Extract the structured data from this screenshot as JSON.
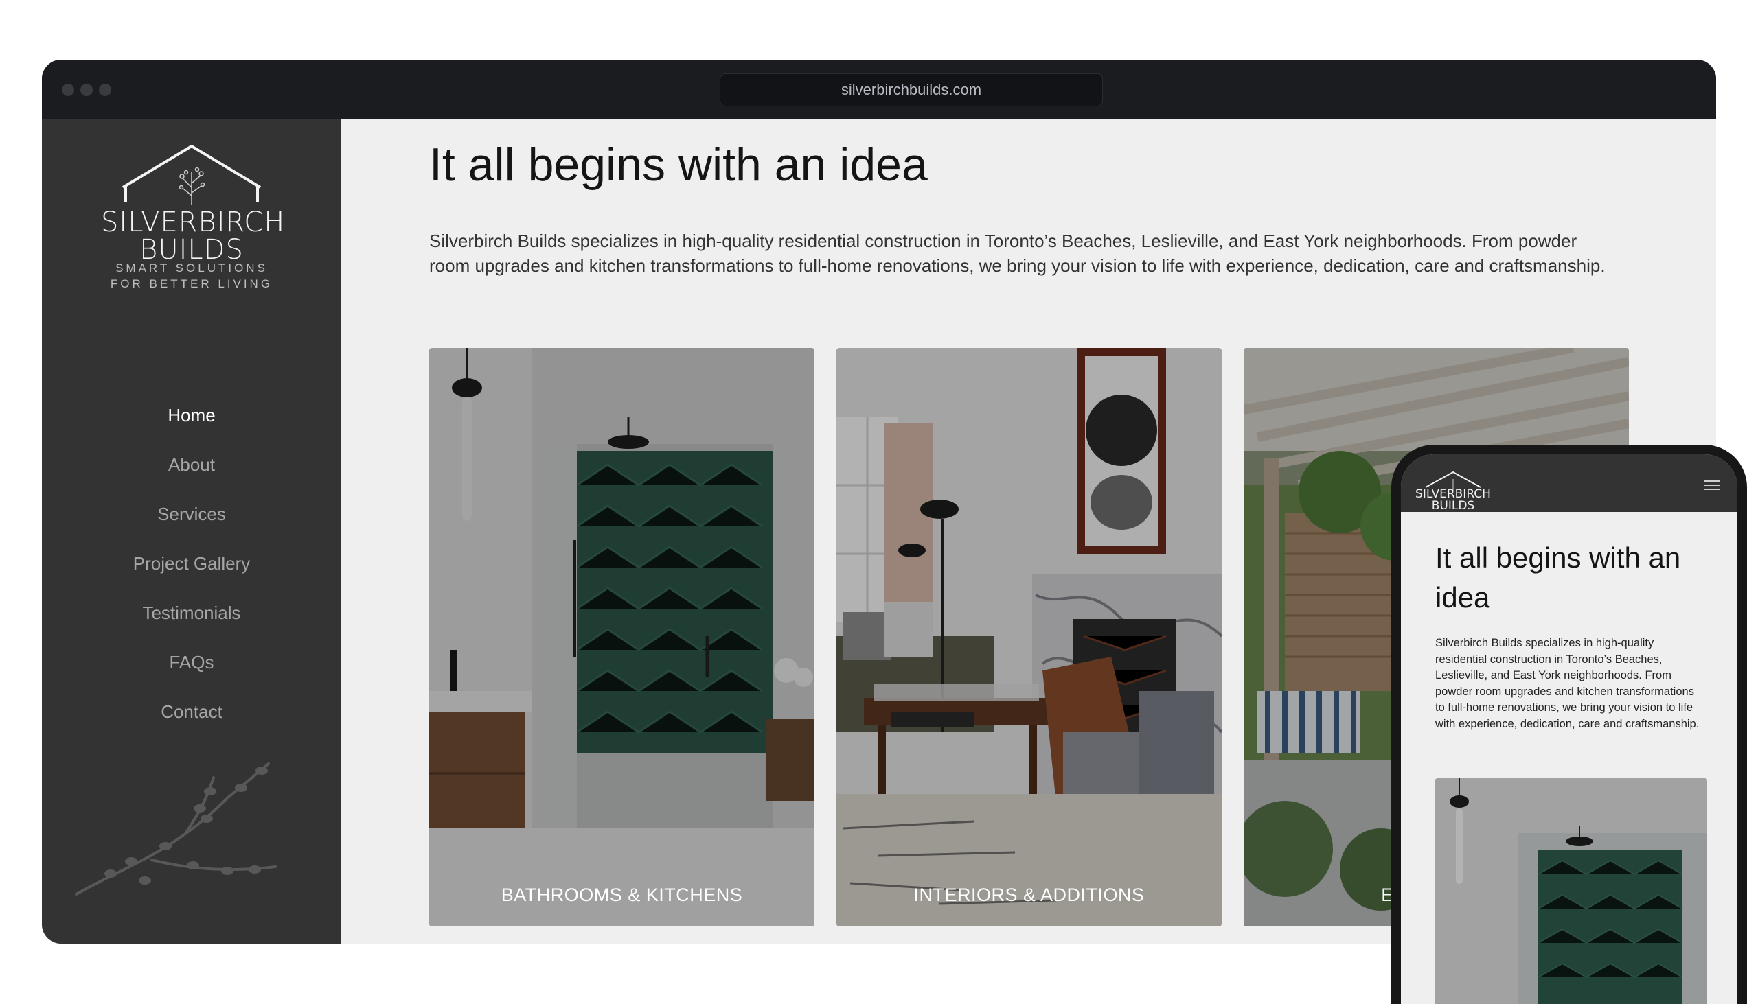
{
  "browser": {
    "url": "silverbirchbuilds.com"
  },
  "brand": {
    "name_line1": "SILVERBIRCH",
    "name_line2": "BUILDS",
    "tagline_line1": "SMART SOLUTIONS",
    "tagline_line2": "FOR BETTER LIVING"
  },
  "nav": {
    "items": [
      {
        "label": "Home",
        "active": true
      },
      {
        "label": "About",
        "active": false
      },
      {
        "label": "Services",
        "active": false
      },
      {
        "label": "Project Gallery",
        "active": false
      },
      {
        "label": "Testimonials",
        "active": false
      },
      {
        "label": "FAQs",
        "active": false
      },
      {
        "label": "Contact",
        "active": false
      }
    ]
  },
  "main": {
    "headline": "It all begins with an idea",
    "intro": "Silverbirch Builds specializes in high-quality residential construction in Toronto’s Beaches, Leslieville, and East York neighborhoods. From powder room upgrades and kitchen transformations to full-home renovations, we bring your vision to life with experience, dedication, care and craftsmanship.",
    "cards": [
      {
        "label": "BATHROOMS & KITCHENS",
        "image": "bathroom-photo"
      },
      {
        "label": "INTERIORS & ADDITIONS",
        "image": "living-room-photo"
      },
      {
        "label": "EXTERIORS",
        "image": "pergola-patio-photo"
      }
    ]
  },
  "mobile": {
    "headline": "It all begins with an idea",
    "intro": "Silverbirch Builds specializes in high-quality residential construction in Toronto’s Beaches, Leslieville, and East York neighborhoods. From powder room upgrades and kitchen transformations to full-home renovations, we bring your vision to life with experience, dedication, care and craftsmanship.",
    "menu_icon": "hamburger-icon"
  },
  "colors": {
    "sidebar": "#333333",
    "page_bg": "#efefef",
    "frame": "#1b1c20",
    "nav_active": "#ffffff",
    "nav_inactive": "#a6a6a6"
  }
}
